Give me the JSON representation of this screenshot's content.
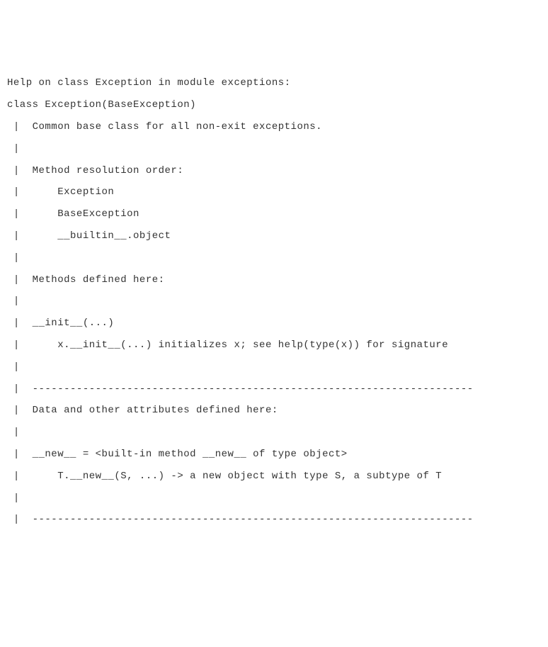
{
  "lines": [
    "Help on class Exception in module exceptions:",
    "",
    "class Exception(BaseException)",
    " |  Common base class for all non-exit exceptions.",
    " |",
    " |  Method resolution order:",
    " |      Exception",
    " |      BaseException",
    " |      __builtin__.object",
    " |",
    " |  Methods defined here:",
    " |",
    " |  __init__(...)",
    " |      x.__init__(...) initializes x; see help(type(x)) for signature",
    " |",
    " |  ----------------------------------------------------------------------",
    " |  Data and other attributes defined here:",
    " |",
    " |  __new__ = <built-in method __new__ of type object>",
    " |      T.__new__(S, ...) -> a new object with type S, a subtype of T",
    " |",
    " |  ----------------------------------------------------------------------"
  ]
}
